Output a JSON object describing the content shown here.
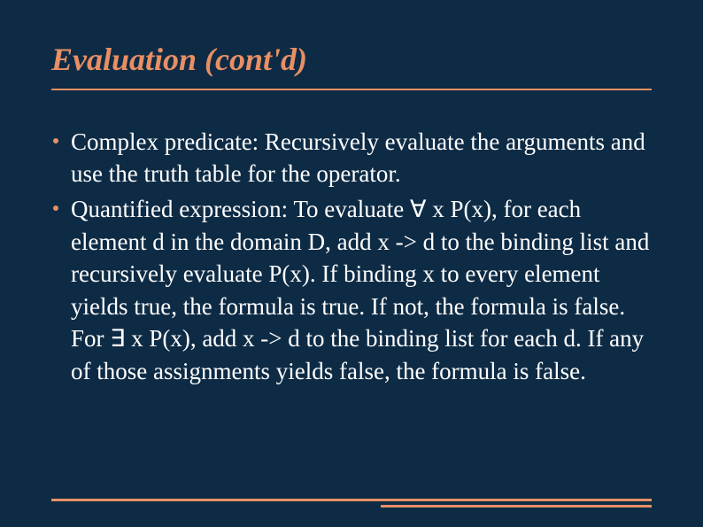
{
  "title": "Evaluation (cont'd)",
  "bullets": [
    "Complex predicate: Recursively evaluate the arguments and use the truth table for the operator.",
    "Quantified expression: To evaluate ∀ x P(x), for each element d in the domain D, add x -> d to the binding list and recursively evaluate P(x). If binding x to every element yields true, the formula is true. If not, the formula is false. For ∃ x P(x), add x -> d to the binding list for each d. If any of those assignments yields false, the formula is false."
  ]
}
